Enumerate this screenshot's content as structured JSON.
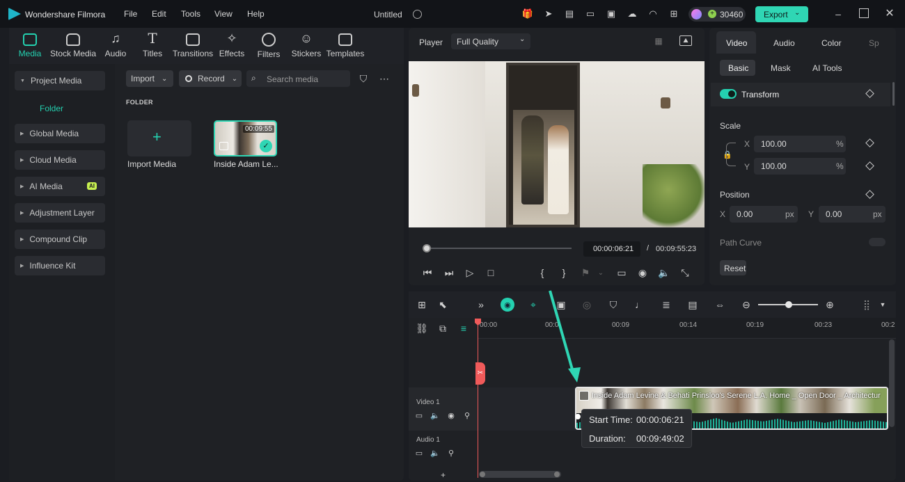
{
  "app": {
    "title": "Wondershare Filmora",
    "doc_title": "Untitled",
    "credits": "30460",
    "export_label": "Export"
  },
  "menu": [
    "File",
    "Edit",
    "Tools",
    "View",
    "Help"
  ],
  "toolbar": [
    "Media",
    "Stock Media",
    "Audio",
    "Titles",
    "Transitions",
    "Effects",
    "Filters",
    "Stickers",
    "Templates"
  ],
  "sidebar": {
    "items": [
      "Project Media",
      "Folder",
      "Global Media",
      "Cloud Media",
      "AI Media",
      "Adjustment Layer",
      "Compound Clip",
      "Influence Kit"
    ],
    "ai_badge": "AI"
  },
  "media": {
    "import_label": "Import",
    "record_label": "Record",
    "search_placeholder": "Search media",
    "folder_label": "FOLDER",
    "import_tile_label": "Import Media",
    "clip_name": "Inside Adam Le...",
    "clip_duration": "00:09:55"
  },
  "player": {
    "label": "Player",
    "quality": "Full Quality",
    "current_time": "00:00:06:21",
    "separator": "/",
    "total_time": "00:09:55:23",
    "progress": 0.011
  },
  "props": {
    "tabs": [
      "Video",
      "Audio",
      "Color",
      "Sp"
    ],
    "subtabs": [
      "Basic",
      "Mask",
      "AI Tools"
    ],
    "transform_label": "Transform",
    "scale_label": "Scale",
    "scale_x_label": "X",
    "scale_x": "100.00",
    "scale_y_label": "Y",
    "scale_y": "100.00",
    "pct": "%",
    "position_label": "Position",
    "pos_x_label": "X",
    "pos_x": "0.00",
    "pos_y_label": "Y",
    "pos_y": "0.00",
    "px": "px",
    "path_curve_label": "Path Curve",
    "reset_label": "Reset"
  },
  "timeline": {
    "ruler": [
      "00:00",
      "00:0",
      "00:09",
      "00:14",
      "00:19",
      "00:23",
      "00:2"
    ],
    "video_track": "Video 1",
    "audio_track": "Audio 1",
    "clip_title": "Inside Adam Levine & Behati Prinsloo's Serene L.A. Home _ Open Door _ Architectur",
    "tooltip": {
      "start_label": "Start Time:",
      "start_value": "00:00:06:21",
      "duration_label": "Duration:",
      "duration_value": "00:09:49:02"
    },
    "add_track": "+"
  },
  "colors": {
    "accent": "#24d1b0",
    "playhead": "#f05a5a",
    "export_bg": "#2fd6b4"
  }
}
